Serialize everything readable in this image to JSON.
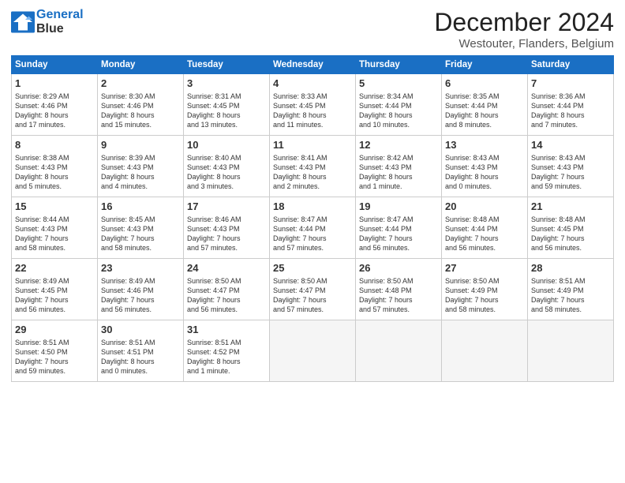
{
  "logo": {
    "line1": "General",
    "line2": "Blue"
  },
  "title": "December 2024",
  "subtitle": "Westouter, Flanders, Belgium",
  "headers": [
    "Sunday",
    "Monday",
    "Tuesday",
    "Wednesday",
    "Thursday",
    "Friday",
    "Saturday"
  ],
  "weeks": [
    [
      {
        "day": "1",
        "info": "Sunrise: 8:29 AM\nSunset: 4:46 PM\nDaylight: 8 hours\nand 17 minutes."
      },
      {
        "day": "2",
        "info": "Sunrise: 8:30 AM\nSunset: 4:46 PM\nDaylight: 8 hours\nand 15 minutes."
      },
      {
        "day": "3",
        "info": "Sunrise: 8:31 AM\nSunset: 4:45 PM\nDaylight: 8 hours\nand 13 minutes."
      },
      {
        "day": "4",
        "info": "Sunrise: 8:33 AM\nSunset: 4:45 PM\nDaylight: 8 hours\nand 11 minutes."
      },
      {
        "day": "5",
        "info": "Sunrise: 8:34 AM\nSunset: 4:44 PM\nDaylight: 8 hours\nand 10 minutes."
      },
      {
        "day": "6",
        "info": "Sunrise: 8:35 AM\nSunset: 4:44 PM\nDaylight: 8 hours\nand 8 minutes."
      },
      {
        "day": "7",
        "info": "Sunrise: 8:36 AM\nSunset: 4:44 PM\nDaylight: 8 hours\nand 7 minutes."
      }
    ],
    [
      {
        "day": "8",
        "info": "Sunrise: 8:38 AM\nSunset: 4:43 PM\nDaylight: 8 hours\nand 5 minutes."
      },
      {
        "day": "9",
        "info": "Sunrise: 8:39 AM\nSunset: 4:43 PM\nDaylight: 8 hours\nand 4 minutes."
      },
      {
        "day": "10",
        "info": "Sunrise: 8:40 AM\nSunset: 4:43 PM\nDaylight: 8 hours\nand 3 minutes."
      },
      {
        "day": "11",
        "info": "Sunrise: 8:41 AM\nSunset: 4:43 PM\nDaylight: 8 hours\nand 2 minutes."
      },
      {
        "day": "12",
        "info": "Sunrise: 8:42 AM\nSunset: 4:43 PM\nDaylight: 8 hours\nand 1 minute."
      },
      {
        "day": "13",
        "info": "Sunrise: 8:43 AM\nSunset: 4:43 PM\nDaylight: 8 hours\nand 0 minutes."
      },
      {
        "day": "14",
        "info": "Sunrise: 8:43 AM\nSunset: 4:43 PM\nDaylight: 7 hours\nand 59 minutes."
      }
    ],
    [
      {
        "day": "15",
        "info": "Sunrise: 8:44 AM\nSunset: 4:43 PM\nDaylight: 7 hours\nand 58 minutes."
      },
      {
        "day": "16",
        "info": "Sunrise: 8:45 AM\nSunset: 4:43 PM\nDaylight: 7 hours\nand 58 minutes."
      },
      {
        "day": "17",
        "info": "Sunrise: 8:46 AM\nSunset: 4:43 PM\nDaylight: 7 hours\nand 57 minutes."
      },
      {
        "day": "18",
        "info": "Sunrise: 8:47 AM\nSunset: 4:44 PM\nDaylight: 7 hours\nand 57 minutes."
      },
      {
        "day": "19",
        "info": "Sunrise: 8:47 AM\nSunset: 4:44 PM\nDaylight: 7 hours\nand 56 minutes."
      },
      {
        "day": "20",
        "info": "Sunrise: 8:48 AM\nSunset: 4:44 PM\nDaylight: 7 hours\nand 56 minutes."
      },
      {
        "day": "21",
        "info": "Sunrise: 8:48 AM\nSunset: 4:45 PM\nDaylight: 7 hours\nand 56 minutes."
      }
    ],
    [
      {
        "day": "22",
        "info": "Sunrise: 8:49 AM\nSunset: 4:45 PM\nDaylight: 7 hours\nand 56 minutes."
      },
      {
        "day": "23",
        "info": "Sunrise: 8:49 AM\nSunset: 4:46 PM\nDaylight: 7 hours\nand 56 minutes."
      },
      {
        "day": "24",
        "info": "Sunrise: 8:50 AM\nSunset: 4:47 PM\nDaylight: 7 hours\nand 56 minutes."
      },
      {
        "day": "25",
        "info": "Sunrise: 8:50 AM\nSunset: 4:47 PM\nDaylight: 7 hours\nand 57 minutes."
      },
      {
        "day": "26",
        "info": "Sunrise: 8:50 AM\nSunset: 4:48 PM\nDaylight: 7 hours\nand 57 minutes."
      },
      {
        "day": "27",
        "info": "Sunrise: 8:50 AM\nSunset: 4:49 PM\nDaylight: 7 hours\nand 58 minutes."
      },
      {
        "day": "28",
        "info": "Sunrise: 8:51 AM\nSunset: 4:49 PM\nDaylight: 7 hours\nand 58 minutes."
      }
    ],
    [
      {
        "day": "29",
        "info": "Sunrise: 8:51 AM\nSunset: 4:50 PM\nDaylight: 7 hours\nand 59 minutes."
      },
      {
        "day": "30",
        "info": "Sunrise: 8:51 AM\nSunset: 4:51 PM\nDaylight: 8 hours\nand 0 minutes."
      },
      {
        "day": "31",
        "info": "Sunrise: 8:51 AM\nSunset: 4:52 PM\nDaylight: 8 hours\nand 1 minute."
      },
      {
        "day": "",
        "info": ""
      },
      {
        "day": "",
        "info": ""
      },
      {
        "day": "",
        "info": ""
      },
      {
        "day": "",
        "info": ""
      }
    ]
  ]
}
